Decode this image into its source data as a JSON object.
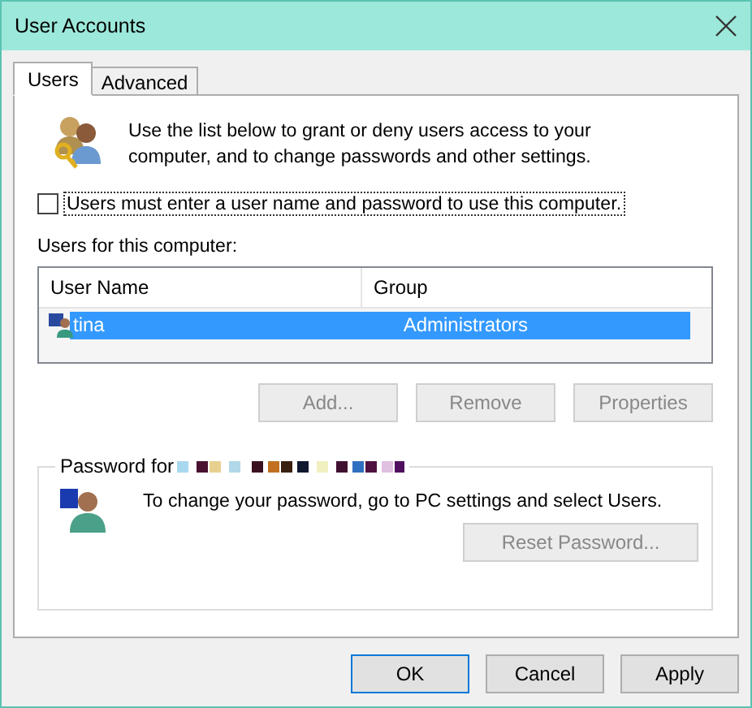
{
  "window": {
    "title": "User Accounts"
  },
  "tabs": [
    {
      "label": "Users",
      "selected": true
    },
    {
      "label": "Advanced",
      "selected": false
    }
  ],
  "intro": "Use the list below to grant or deny users access to your computer, and to change passwords and other settings.",
  "require_login": {
    "label": "Users must enter a user name and password to use this computer.",
    "checked": false
  },
  "users_label": "Users for this computer:",
  "table": {
    "columns": [
      "User Name",
      "Group"
    ],
    "rows": [
      {
        "name": "tina",
        "group": "Administrators",
        "selected": true
      }
    ]
  },
  "list_buttons": [
    {
      "label": "Add...",
      "disabled": true
    },
    {
      "label": "Remove",
      "disabled": true
    },
    {
      "label": "Properties",
      "disabled": true
    }
  ],
  "password": {
    "title": "Password for",
    "text": "To change your password, go to PC settings and select Users.",
    "button": {
      "label": "Reset Password...",
      "disabled": true
    }
  },
  "buttons": [
    {
      "label": "OK",
      "disabled": false
    },
    {
      "label": "Cancel",
      "disabled": false
    },
    {
      "label": "Apply",
      "disabled": false
    }
  ]
}
